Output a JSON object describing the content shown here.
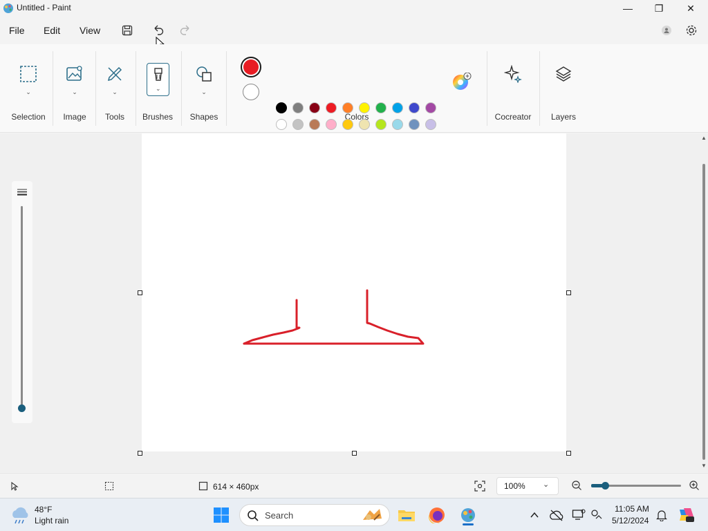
{
  "window": {
    "title": "Untitled - Paint",
    "minimize": "—",
    "maximize": "❐",
    "close": "✕"
  },
  "menu": {
    "file": "File",
    "edit": "Edit",
    "view": "View"
  },
  "ribbon": {
    "groups": {
      "selection": "Selection",
      "image": "Image",
      "tools": "Tools",
      "brushes": "Brushes",
      "shapes": "Shapes",
      "colors": "Colors",
      "cocreator": "Cocreator",
      "layers": "Layers"
    },
    "primary_color": "#e81c24",
    "secondary_color": "#ffffff",
    "palette_row1": [
      "#000000",
      "#7f7f7f",
      "#880015",
      "#ed1c24",
      "#ff7f27",
      "#fff200",
      "#22b14c",
      "#00a2e8",
      "#3f48cc",
      "#a349a4"
    ],
    "palette_row2": [
      "#ffffff",
      "#c3c3c3",
      "#b97a57",
      "#ffaec9",
      "#ffc90e",
      "#efe4b0",
      "#b5e61d",
      "#99d9ea",
      "#7092be",
      "#c8bfe7"
    ],
    "palette_row3": [
      "#ffffff",
      "#ffffff",
      "#ffffff",
      "#ffffff",
      "#ffffff",
      "#ffffff",
      "#ffffff",
      "#ffffff",
      "#ffffff",
      "#ffffff"
    ]
  },
  "canvas": {
    "stroke_color": "#d9202a"
  },
  "status": {
    "dimensions": "614 × 460px",
    "zoom": "100%"
  },
  "taskbar": {
    "weather_temp": "48°F",
    "weather_desc": "Light rain",
    "search_placeholder": "Search",
    "time": "11:05 AM",
    "date": "5/12/2024"
  }
}
